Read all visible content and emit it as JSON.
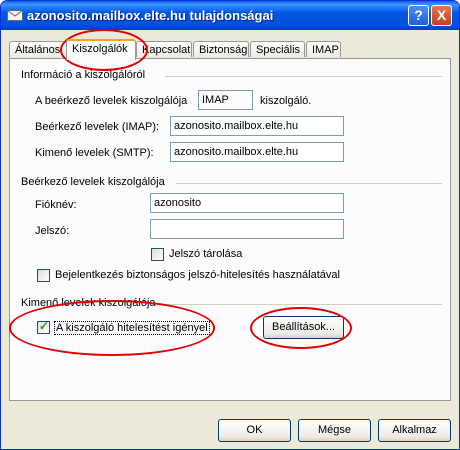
{
  "window": {
    "title": "azonosito.mailbox.elte.hu tulajdonságai",
    "help_label": "?",
    "close_label": "X"
  },
  "tabs": [
    "Általános",
    "Kiszolgálók",
    "Kapcsolat",
    "Biztonság",
    "Speciális",
    "IMAP"
  ],
  "server_info": {
    "group_label": "Információ a kiszolgálóról",
    "incoming_server_type_label": "A beérkező levelek kiszolgálója",
    "incoming_server_type_value": "IMAP",
    "incoming_server_type_suffix": "kiszolgáló.",
    "incoming_label": "Beérkező levelek (IMAP):",
    "incoming_value": "azonosito.mailbox.elte.hu",
    "outgoing_label": "Kimenő levelek (SMTP):",
    "outgoing_value": "azonosito.mailbox.elte.hu"
  },
  "incoming_server": {
    "group_label": "Beérkező levelek kiszolgálója",
    "account_label": "Fióknév:",
    "account_value": "azonosito",
    "password_label": "Jelszó:",
    "password_value": "",
    "remember_password_label": "Jelszó tárolása",
    "remember_password_checked": false,
    "spa_label": "Bejelentkezés biztonságos jelszó-hitelesítés használatával",
    "spa_checked": false
  },
  "outgoing_server": {
    "group_label": "Kimenő levelek kiszolgálója",
    "auth_label": "A kiszolgáló hitelesítést igényel",
    "auth_checked": true,
    "settings_button": "Beállítások..."
  },
  "footer": {
    "ok": "OK",
    "cancel": "Mégse",
    "apply": "Alkalmaz"
  },
  "colors": {
    "annotation": "#e00000",
    "title_bar": "#0058e6",
    "check_mark": "#21a121"
  }
}
